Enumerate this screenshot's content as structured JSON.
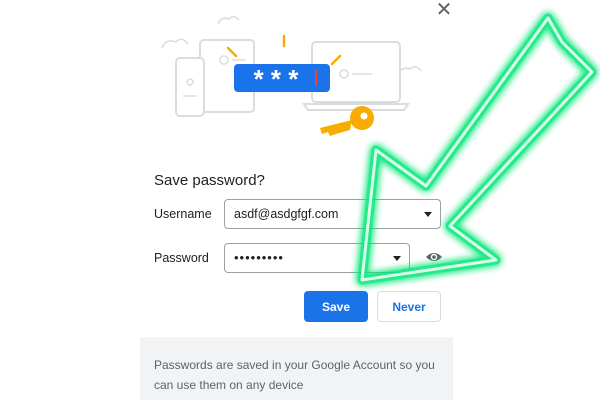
{
  "dialog": {
    "title": "Save password?",
    "close_icon": "close-icon",
    "illustration": {
      "masked_password": "* * *",
      "icons": [
        "key-icon",
        "laptop-icon",
        "phone-icon",
        "tablet-icon"
      ]
    },
    "username": {
      "label": "Username",
      "value": "asdf@asdgfgf.com"
    },
    "password": {
      "label": "Password",
      "value": "•••••••••"
    },
    "save_label": "Save",
    "never_label": "Never",
    "footer_text": "Passwords are saved in your Google Account so you can use them on any device"
  },
  "colors": {
    "primary": "#1a73e8",
    "key": "#f9ab00",
    "arrow_glow": "#00e676",
    "footer_bg": "#f1f3f4"
  }
}
